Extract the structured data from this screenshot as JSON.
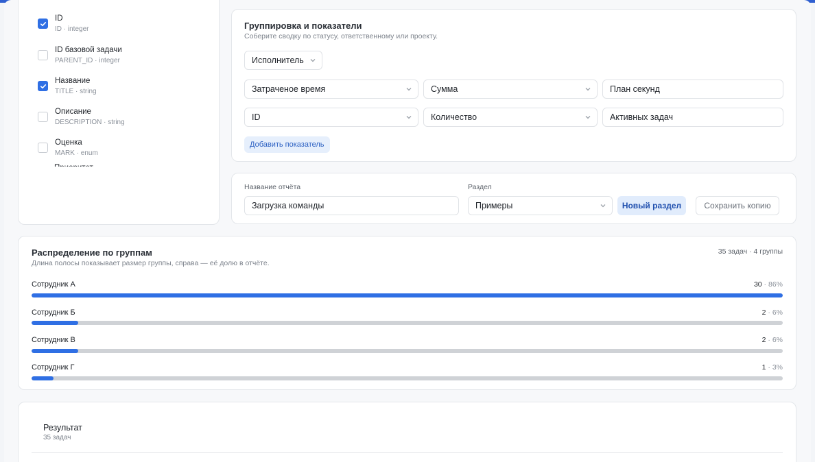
{
  "fields": [
    {
      "title": "ID",
      "sub": "ID · integer",
      "checked": true
    },
    {
      "title": "ID базовой задачи",
      "sub": "PARENT_ID · integer",
      "checked": false
    },
    {
      "title": "Название",
      "sub": "TITLE · string",
      "checked": true
    },
    {
      "title": "Описание",
      "sub": "DESCRIPTION · string",
      "checked": false
    },
    {
      "title": "Оценка",
      "sub": "MARK · enum",
      "checked": false
    }
  ],
  "fields_clipped_label": "Приоритет",
  "grouping": {
    "title": "Группировка и показатели",
    "subtitle": "Соберите сводку по статусу, ответственному или проекту.",
    "group_by": "Исполнитель",
    "metrics": [
      {
        "field": "Затраченое время",
        "aggregate": "Сумма",
        "label": "План секунд"
      },
      {
        "field": "ID",
        "aggregate": "Количество",
        "label": "Активных задач"
      }
    ],
    "add_metric_label": "Добавить показатель"
  },
  "report": {
    "name_label": "Название отчёта",
    "name_value": "Загрузка команды",
    "section_label": "Раздел",
    "section_value": "Примеры",
    "new_section_label": "Новый раздел",
    "save_copy_label": "Сохранить копию"
  },
  "distribution": {
    "title": "Распределение по группам",
    "subtitle": "Длина полосы показывает размер группы, справа — её долю в отчёте.",
    "summary": "35 задач · 4 группы",
    "rows": [
      {
        "name": "Сотрудник А",
        "count": "30",
        "share": "86%",
        "fraction": 1.0
      },
      {
        "name": "Сотрудник Б",
        "count": "2",
        "share": "6%",
        "fraction": 0.062
      },
      {
        "name": "Сотрудник В",
        "count": "2",
        "share": "6%",
        "fraction": 0.062
      },
      {
        "name": "Сотрудник Г",
        "count": "1",
        "share": "3%",
        "fraction": 0.029
      }
    ],
    "accent": "#2f6fe4"
  },
  "result": {
    "title": "Результат",
    "subtitle": "35 задач"
  }
}
